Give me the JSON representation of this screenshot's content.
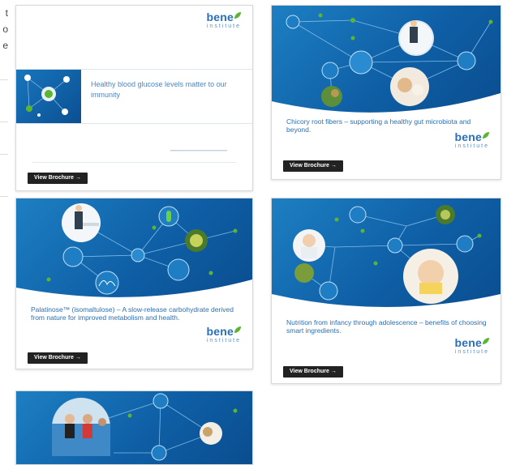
{
  "edge_text": [
    "t",
    "o",
    "e"
  ],
  "brand": {
    "name": "bene",
    "subtitle": "institute"
  },
  "cards": [
    {
      "headline": "Healthy blood glucose levels matter to our immunity",
      "button": "View Brochure →"
    },
    {
      "caption": "Chicory root fibers – supporting a healthy gut microbiota and beyond.",
      "button": "View Brochure →"
    },
    {
      "caption": "Palatinose™ (isomaltulose) – A slow-release carbohydrate derived from nature for improved metabolism and health.",
      "button": "View Brochure →"
    },
    {
      "caption": "Nutrition from infancy through adolescence – benefits of choosing smart ingredients.",
      "button": "View Brochure →"
    }
  ],
  "colors": {
    "cover_blue": "#1571b8",
    "caption_blue": "#2b6fb3",
    "accent_green": "#5cb531",
    "button_dark": "#222222"
  }
}
